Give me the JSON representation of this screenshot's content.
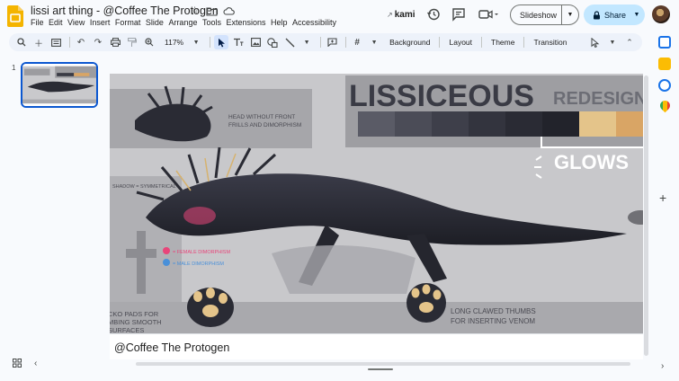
{
  "app": {
    "title": "lissi art thing - @Coffee The Protogen",
    "menu": [
      "File",
      "Edit",
      "View",
      "Insert",
      "Format",
      "Slide",
      "Arrange",
      "Tools",
      "Extensions",
      "Help",
      "Accessibility"
    ],
    "kami": "kami",
    "slideshow_label": "Slideshow",
    "share_label": "Share"
  },
  "toolbar": {
    "zoom": "117%",
    "background_label": "Background",
    "layout_label": "Layout",
    "theme_label": "Theme",
    "transition_label": "Transition"
  },
  "filmstrip": {
    "slide_number": "1"
  },
  "slide": {
    "heading": "LISSICEOUS",
    "heading_cut": "REDESIGN",
    "glows": "GLOWS",
    "note_head_1": "HEAD WITHOUT FRONT",
    "note_head_2": "FRILLS AND DIMORPHISM",
    "note_shadow": "SHADOW = SYMMETRICAL",
    "legend_female": "= FEMALE DIMORPHISM",
    "legend_male": "= MALE DIMORPHISM",
    "note_feet_1": "CKO PADS FOR",
    "note_feet_2": "MBING SMOOTH",
    "note_feet_3": "SURFACES",
    "note_thumbs_1": "LONG CLAWED THUMBS",
    "note_thumbs_2": "FOR INSERTING VENOM",
    "palette": [
      "#5a5b66",
      "#4b4c57",
      "#3e3f4a",
      "#33343e",
      "#2a2b34",
      "#22232b",
      "#e4c48a",
      "#d9a565",
      "#c98646"
    ],
    "female_color": "#e8457a",
    "male_color": "#4a90d9"
  },
  "notes": {
    "text": "@Coffee The Protogen"
  }
}
